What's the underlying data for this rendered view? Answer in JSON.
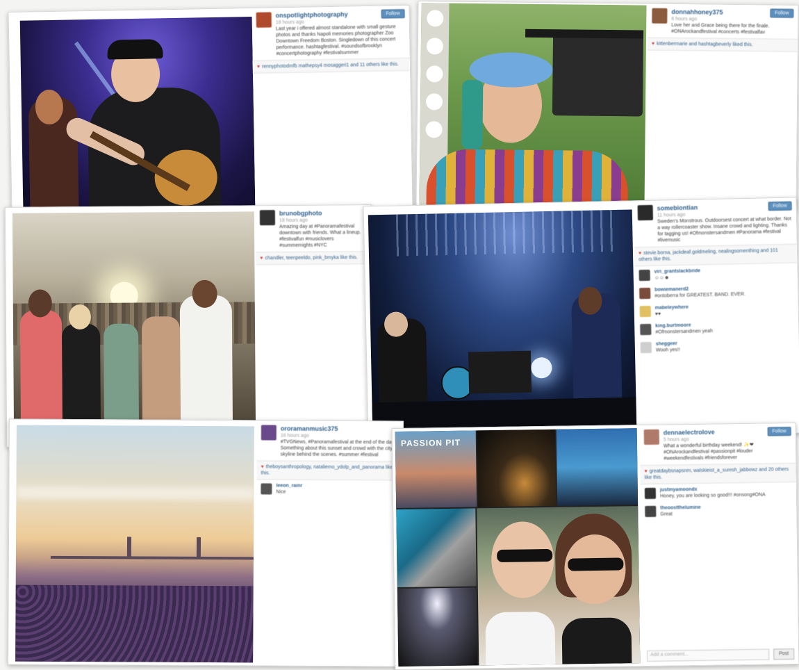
{
  "posts": [
    {
      "username": "onspotlightphotography",
      "time": "18 hours ago",
      "caption": "Last year i offered almost standalone with small gesture photos and thanks Napoli memories photographer Zoo Downtown Freedom Boston. Singledown of this concert performance. hashtagfestival. #soundsofbrooklyn #concertphotography #festivalsummer",
      "follow_label": "Follow",
      "likes_text": "rennyphotodmfb  mathepsy4  mosaggeri1 and 11 others like this.",
      "comments": []
    },
    {
      "username": "donnahhoney375",
      "time": "6 hours ago",
      "caption": "Love her and Grace being there for the finale. #ONArockandfestival #concerts #festivalfav",
      "follow_label": "Follow",
      "likes_text": "kittenbermarie  and  hashtagbeverly liked this.",
      "comments": []
    },
    {
      "username": "brunobgphoto",
      "time": "19 hours ago",
      "caption": "Amazing day at #Panoramafestival downtown with friends. What a lineup. #festivalfun #musiclovers #summernights #NYC",
      "follow_label": "",
      "likes_text": "chandler, teenpeeldo, pink_bmyka like this.",
      "comments": []
    },
    {
      "username": "somebiontian",
      "time": "11 hours ago",
      "caption": "Sweden's Monstrous. Outdoorsest concert at what border. Not a way rollercoaster show. Insane crowd and lighting. Thanks for tagging us! #Ofmonstersandmen #Panorama #festival #livemusic",
      "follow_label": "Follow",
      "likes_text": "stevie.borna, jackdeaf.goldmeling, nealingsomenthing and 101 others like this.",
      "comments": [
        {
          "user": "viri_grantslackbride",
          "text": "☺☺☻"
        },
        {
          "user": "bowiemanerd2",
          "text": "#ontoberra for GREATEST. BAND. EVER."
        },
        {
          "user": "mabeleywhere",
          "text": "♥♥"
        },
        {
          "user": "king.burtmoore",
          "text": "#Ofmonstersandmen yeah"
        },
        {
          "user": "sheggeer",
          "text": "Wooh yes!!"
        }
      ]
    },
    {
      "username": "ororamanmusic375",
      "time": "16 hours ago",
      "caption": "#TVGNews, #Panoramafestival at the end of the day. Something about this sunset and crowd with the city skyline behind the scenes. #summer #festival",
      "follow_label": "",
      "likes_text": "theboysanthropology, nataliemo_ydolp_and_panorama like this.",
      "comments": [
        {
          "user": "leeon_rainr",
          "text": "Nice"
        }
      ]
    },
    {
      "username": "dennaelectrolove",
      "time": "5 hours ago",
      "caption": "What a wonderful birthday weekend! ✨❤ #ONArockandfestival #passionpit #louder #weekendfestivals #friendsforever",
      "follow_label": "Follow",
      "likes_text": "greatdaybsnapsnm, walskieist_a_suresh_jabbowz and 20 others like this.",
      "comments": [
        {
          "user": "justmyamoondx",
          "text": "Honey, you are looking so good!!! #onsong#ONA"
        },
        {
          "user": "theoostthelumine",
          "text": "Great"
        }
      ],
      "comment_placeholder": "Add a comment...",
      "comment_button": "Post"
    }
  ],
  "collage_band_text": "PASSION PIT"
}
